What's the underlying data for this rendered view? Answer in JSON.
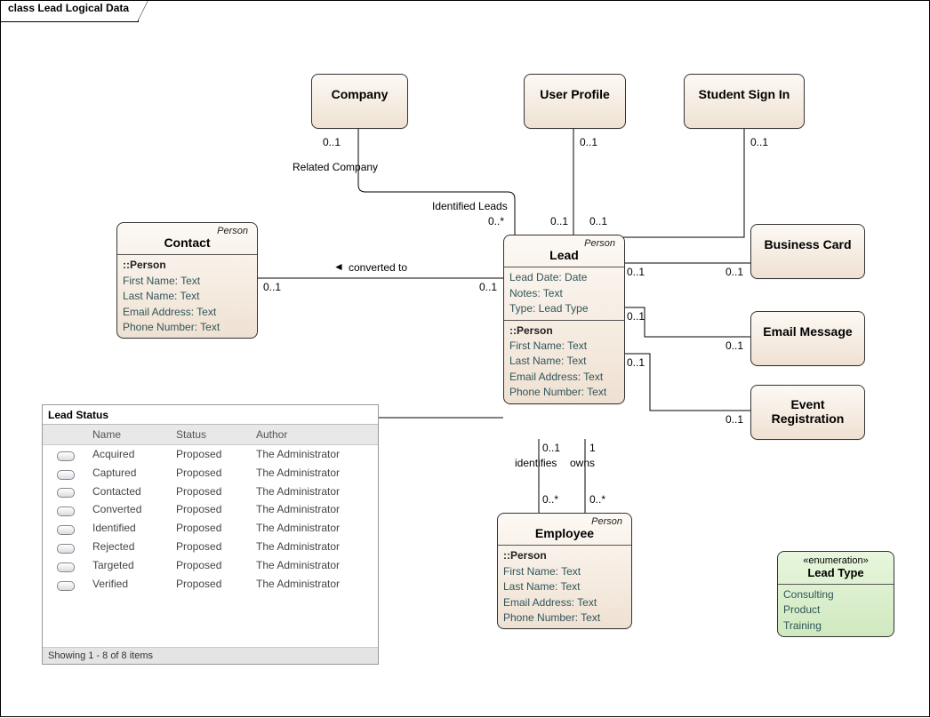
{
  "diagram": {
    "title": "class Lead Logical Data"
  },
  "stereotypes": {
    "person": "Person",
    "enumeration": "«enumeration»"
  },
  "classes": {
    "company": {
      "name": "Company"
    },
    "userProfile": {
      "name": "User Profile"
    },
    "studentSignIn": {
      "name": "Student Sign In"
    },
    "businessCard": {
      "name": "Business Card"
    },
    "emailMessage": {
      "name": "Email Message"
    },
    "eventReg": {
      "name": "Event Registration"
    },
    "contact": {
      "name": "Contact"
    },
    "lead": {
      "name": "Lead"
    },
    "employee": {
      "name": "Employee"
    }
  },
  "sections": {
    "personTitle": "::Person",
    "firstName": "First Name: Text",
    "lastName": "Last Name: Text",
    "email": "Email Address: Text",
    "phone": "Phone Number: Text"
  },
  "leadAttrs": {
    "leadDate": "Lead Date: Date",
    "notes": "Notes: Text",
    "type": "Type: Lead Type"
  },
  "enum": {
    "name": "Lead Type",
    "values": {
      "v1": "Consulting",
      "v2": "Product",
      "v3": "Training"
    }
  },
  "assoc": {
    "relatedCompany": "Related Company",
    "identifiedLeads": "Identified Leads",
    "convertedTo": "converted to",
    "identifies": "identifies",
    "owns": "owns"
  },
  "mult": {
    "m01": "0..1",
    "m0s": "0..*",
    "m1": "1"
  },
  "leadStatus": {
    "title": "Lead Status",
    "columns": {
      "name": "Name",
      "status": "Status",
      "author": "Author"
    },
    "rows": [
      {
        "name": "Acquired",
        "status": "Proposed",
        "author": "The Administrator"
      },
      {
        "name": "Captured",
        "status": "Proposed",
        "author": "The Administrator"
      },
      {
        "name": "Contacted",
        "status": "Proposed",
        "author": "The Administrator"
      },
      {
        "name": "Converted",
        "status": "Proposed",
        "author": "The Administrator"
      },
      {
        "name": "Identified",
        "status": "Proposed",
        "author": "The Administrator"
      },
      {
        "name": "Rejected",
        "status": "Proposed",
        "author": "The Administrator"
      },
      {
        "name": "Targeted",
        "status": "Proposed",
        "author": "The Administrator"
      },
      {
        "name": "Verified",
        "status": "Proposed",
        "author": "The Administrator"
      }
    ],
    "footer": "Showing  1 - 8 of 8 items"
  }
}
